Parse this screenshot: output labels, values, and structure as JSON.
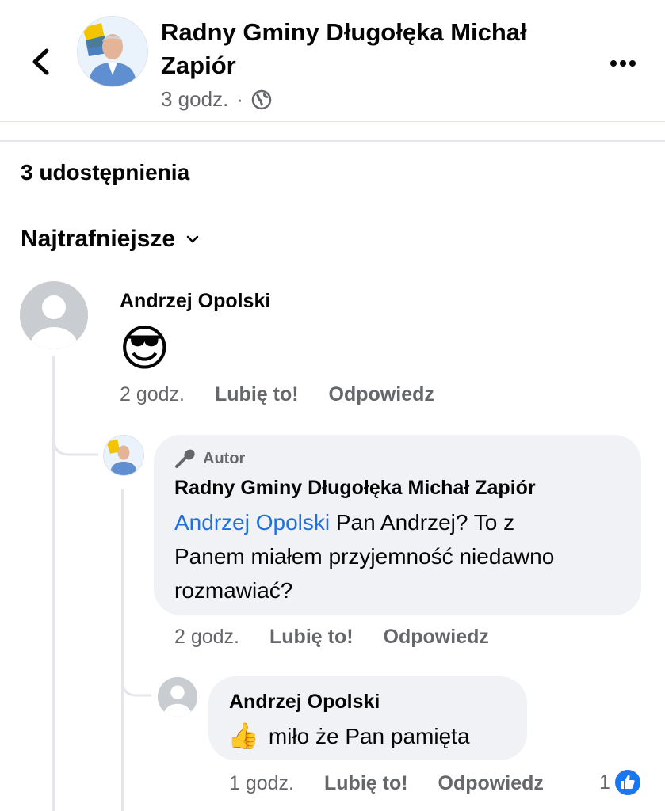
{
  "header": {
    "page_name": "Radny Gminy Długołęka Michał Zapiór",
    "time": "3 godz.",
    "separator": "·",
    "privacy_icon": "globe-icon",
    "back_icon": "chevron-left-icon",
    "more_icon": "more-horizontal-icon"
  },
  "shares": "3 udostępnienia",
  "sort_label": "Najtrafniejsze",
  "comments": [
    {
      "author": "Andrzej Opolski",
      "text": "😎",
      "time": "2 godz.",
      "like": "Lubię to!",
      "reply": "Odpowiedz",
      "replies": [
        {
          "badge": "Autor",
          "author": "Radny Gminy Długołęka Michał Zapiór",
          "mention": "Andrzej Opolski",
          "text_line1": " Pan Andrzej? To z",
          "text_line2": "Panem miałem przyjemność niedawno",
          "text_line3": "rozmawiać?",
          "time": "2 godz.",
          "like": "Lubię to!",
          "reply": "Odpowiedz"
        },
        {
          "author": "Andrzej Opolski",
          "emoji": "👍",
          "text": "miło że Pan pamięta",
          "time": "1 godz.",
          "like": "Lubię to!",
          "reply": "Odpowiedz",
          "reaction_count": "1"
        }
      ]
    }
  ],
  "colors": {
    "link": "#216fdb",
    "secondary_text": "#65676b",
    "bubble": "#f0f2f5",
    "like_blue": "#1877f2"
  }
}
